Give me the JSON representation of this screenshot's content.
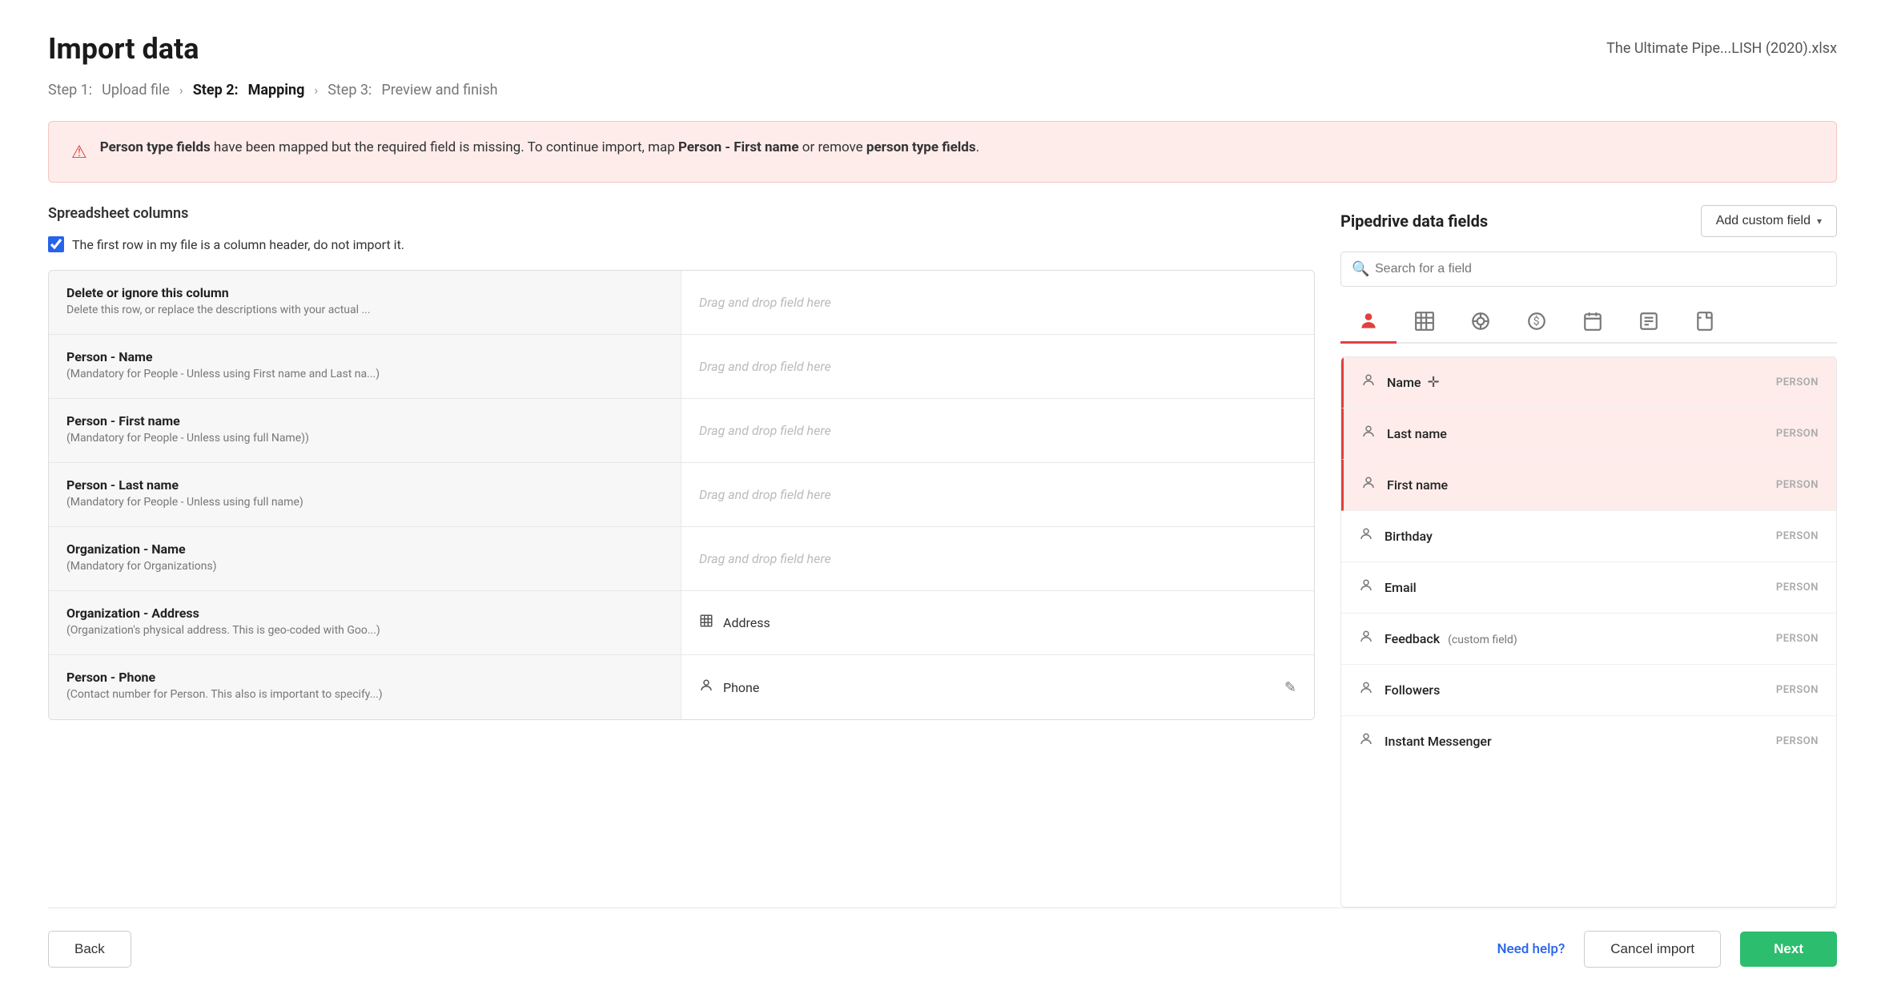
{
  "page": {
    "title": "Import data",
    "file_name": "The Ultimate Pipe...LISH (2020).xlsx"
  },
  "steps": {
    "step1_label": "Step 1:",
    "step1_name": "Upload file",
    "step2_label": "Step 2:",
    "step2_name": "Mapping",
    "step3_label": "Step 3:",
    "step3_name": "Preview and finish"
  },
  "alert": {
    "text_part1": "Person type fields",
    "text_part2": " have been mapped but the required field is missing. To continue import, map ",
    "text_bold2": "Person - First name",
    "text_part3": " or remove ",
    "text_bold3": "person type fields",
    "text_part4": "."
  },
  "left_panel": {
    "spreadsheet_label": "Spreadsheet columns",
    "checkbox_label": "The first row in my file is a column header, do not import it.",
    "rows": [
      {
        "title": "Delete or ignore this column",
        "subtitle": "Delete this row, or replace the descriptions with your actual ...",
        "mapped_field": null,
        "drag_placeholder": "Drag and drop field here"
      },
      {
        "title": "Person - Name",
        "subtitle": "(Mandatory for People - Unless using First name and Last na...)",
        "mapped_field": null,
        "drag_placeholder": "Drag and drop field here"
      },
      {
        "title": "Person - First name",
        "subtitle": "(Mandatory for People - Unless using full Name))",
        "mapped_field": null,
        "drag_placeholder": "Drag and drop field here"
      },
      {
        "title": "Person - Last name",
        "subtitle": "(Mandatory for People - Unless using full name)",
        "mapped_field": null,
        "drag_placeholder": "Drag and drop field here"
      },
      {
        "title": "Organization - Name",
        "subtitle": "(Mandatory for Organizations)",
        "mapped_field": null,
        "drag_placeholder": "Drag and drop field here"
      },
      {
        "title": "Organization - Address",
        "subtitle": "(Organization's physical address. This is geo-coded with Goo...)",
        "mapped_field": "Address",
        "mapped_icon": "building"
      },
      {
        "title": "Person - Phone",
        "subtitle": "(Contact number for Person. This also is important to specify...)",
        "mapped_field": "Phone",
        "mapped_icon": "person",
        "has_edit": true
      }
    ]
  },
  "right_panel": {
    "title": "Pipedrive data fields",
    "add_custom_btn": "Add custom field",
    "search_placeholder": "Search for a field",
    "tabs": [
      {
        "icon": "person",
        "label": "Person",
        "active": true
      },
      {
        "icon": "building",
        "label": "Organization",
        "active": false
      },
      {
        "icon": "target",
        "label": "Deal",
        "active": false
      },
      {
        "icon": "dollar",
        "label": "Price",
        "active": false
      },
      {
        "icon": "calendar",
        "label": "Calendar",
        "active": false
      },
      {
        "icon": "note",
        "label": "Note",
        "active": false
      },
      {
        "icon": "file",
        "label": "File",
        "active": false
      }
    ],
    "fields": [
      {
        "name": "Name",
        "type": "PERSON",
        "highlighted": true,
        "has_move": true
      },
      {
        "name": "Last name",
        "type": "PERSON",
        "highlighted": true
      },
      {
        "name": "First name",
        "type": "PERSON",
        "highlighted": true
      },
      {
        "name": "Birthday",
        "type": "PERSON",
        "highlighted": false
      },
      {
        "name": "Email",
        "type": "PERSON",
        "highlighted": false
      },
      {
        "name": "Feedback",
        "type": "PERSON",
        "highlighted": false,
        "custom": true
      },
      {
        "name": "Followers",
        "type": "PERSON",
        "highlighted": false
      },
      {
        "name": "Instant Messenger",
        "type": "PERSON",
        "highlighted": false
      }
    ]
  },
  "footer": {
    "back_label": "Back",
    "need_help_label": "Need help?",
    "cancel_label": "Cancel import",
    "next_label": "Next"
  }
}
